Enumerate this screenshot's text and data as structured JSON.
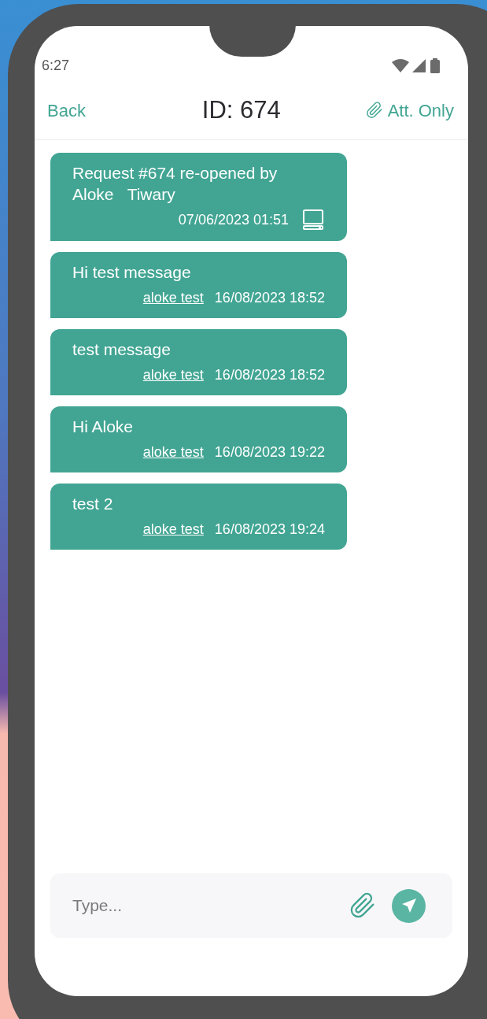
{
  "status_bar": {
    "time": "6:27"
  },
  "header": {
    "back": "Back",
    "title": "ID: 674",
    "filter": "Att. Only"
  },
  "messages": [
    {
      "kind": "system",
      "text": "Request #674 re-opened by Aloke   Tiwary",
      "time": "07/06/2023 01:51"
    },
    {
      "kind": "user",
      "text": "Hi test message",
      "author": "aloke test",
      "time": "16/08/2023 18:52"
    },
    {
      "kind": "user",
      "text": "test message",
      "author": "aloke test",
      "time": "16/08/2023 18:52"
    },
    {
      "kind": "user",
      "text": "Hi Aloke",
      "author": "aloke test",
      "time": "16/08/2023 19:22"
    },
    {
      "kind": "user",
      "text": "test 2",
      "author": "aloke test",
      "time": "16/08/2023 19:24"
    }
  ],
  "composer": {
    "placeholder": "Type..."
  }
}
